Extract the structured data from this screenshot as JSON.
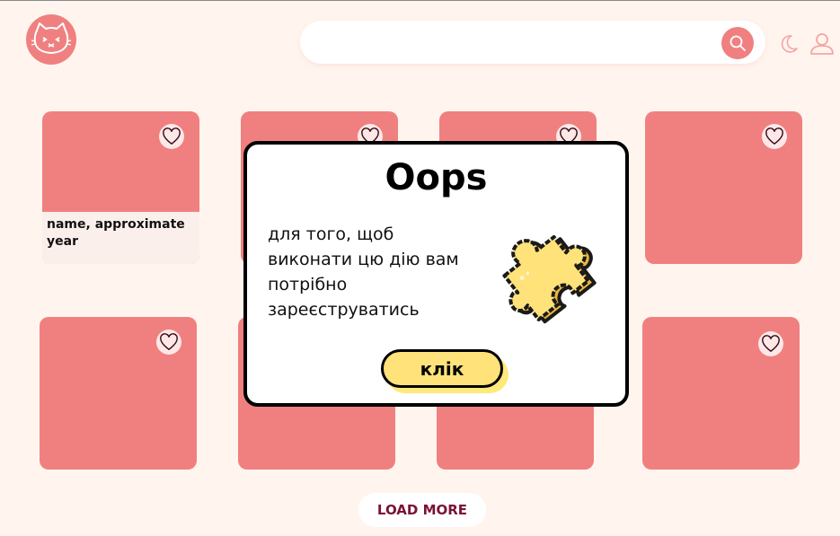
{
  "header": {
    "logo_icon": "cat-face-icon",
    "search": {
      "value": "",
      "placeholder": ""
    },
    "search_button_icon": "search-icon",
    "theme_toggle_icon": "moon-icon",
    "profile_icon": "user-icon"
  },
  "gallery": {
    "cards": [
      {
        "caption": "name, approximate year",
        "favorite_icon": "heart-icon"
      },
      {
        "caption": "",
        "favorite_icon": "heart-icon"
      },
      {
        "caption": "",
        "favorite_icon": "heart-icon"
      },
      {
        "caption": "",
        "favorite_icon": "heart-icon"
      },
      {
        "caption": "",
        "favorite_icon": "heart-icon"
      },
      {
        "caption": "",
        "favorite_icon": "heart-icon"
      },
      {
        "caption": "",
        "favorite_icon": "heart-icon"
      },
      {
        "caption": "",
        "favorite_icon": "heart-icon"
      }
    ],
    "load_more_label": "LOAD MORE"
  },
  "modal": {
    "title": "Oops",
    "message_lines": [
      "для того, щоб",
      "виконати цю дію вам",
      "потрібно",
      "зареєструватись"
    ],
    "illustration_icon": "puzzle-piece-icon",
    "button_label": "клік"
  },
  "colors": {
    "background": "#fff5ee",
    "accent": "#f08080",
    "card_caption_bg": "#fbefec",
    "button_yellow": "#ffe27a",
    "load_more_text": "#7a1236"
  }
}
